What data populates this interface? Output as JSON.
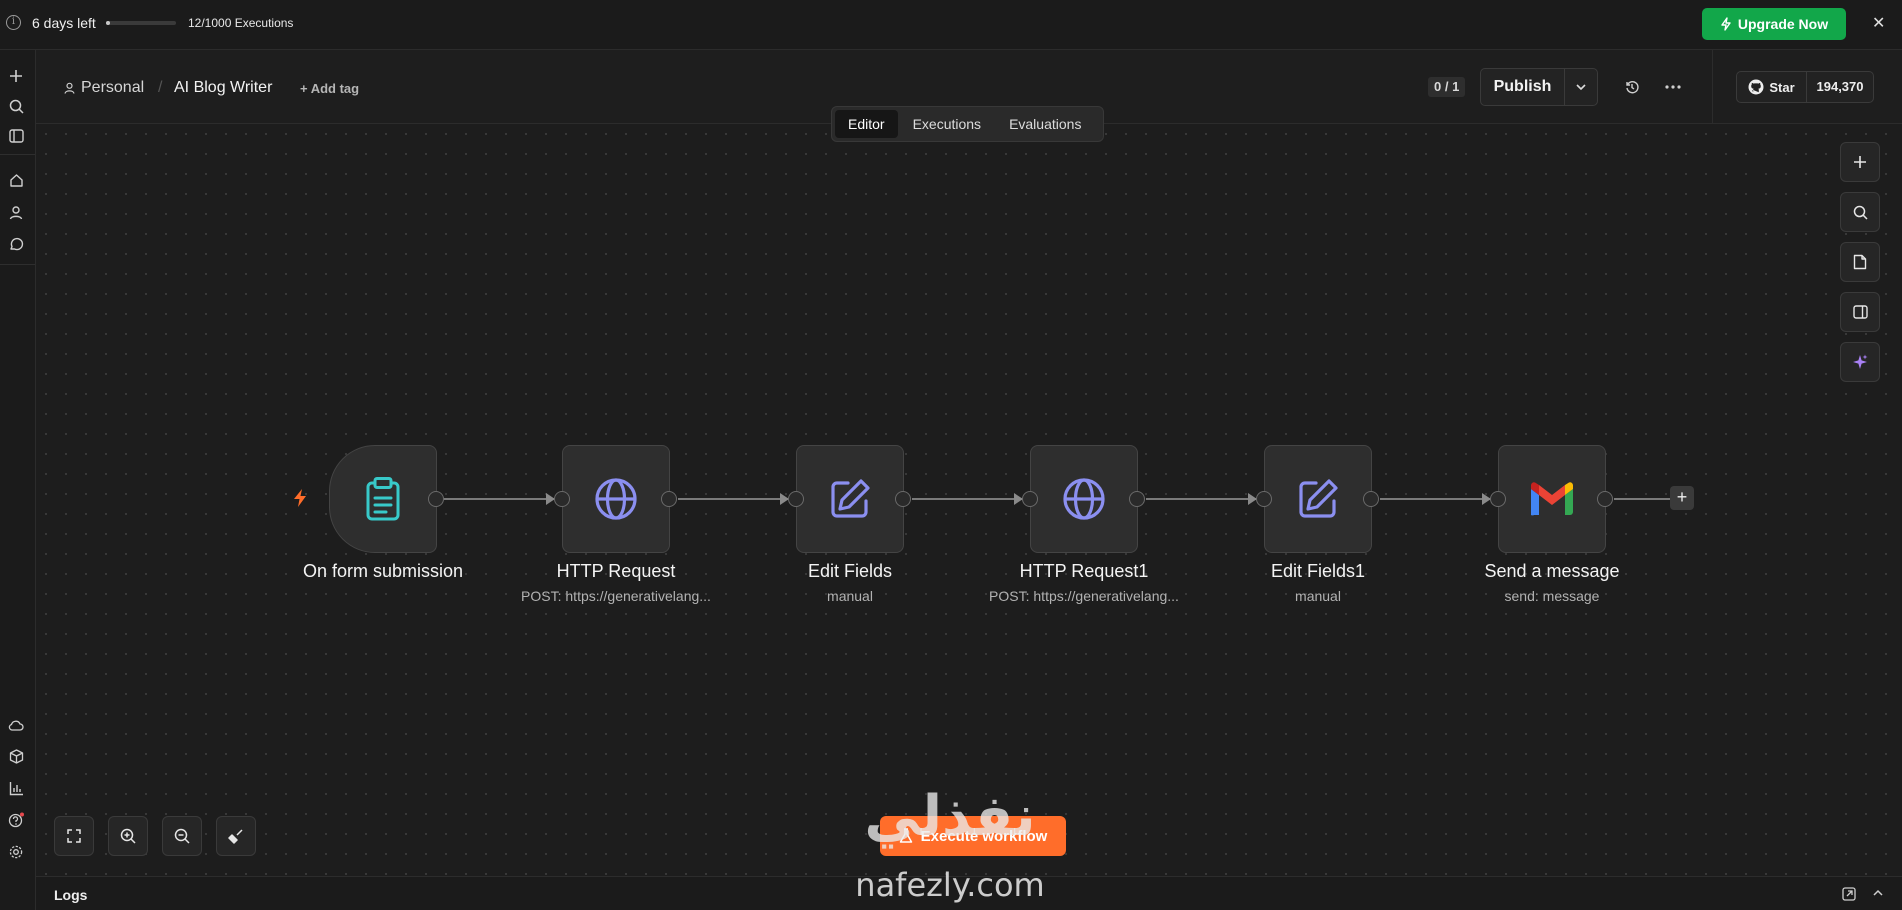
{
  "banner": {
    "trial_text": "6 days left",
    "executions_progress": 0.012,
    "executions_text": "12/1000 Executions",
    "upgrade_label": "Upgrade Now"
  },
  "header": {
    "project": "Personal",
    "workflow_title": "AI Blog Writer",
    "add_tag": "+ Add tag",
    "version_counter": "0 / 1",
    "publish_label": "Publish"
  },
  "github": {
    "star_label": "Star",
    "star_count": "194,370"
  },
  "tabs": [
    {
      "label": "Editor",
      "active": true
    },
    {
      "label": "Executions",
      "active": false
    },
    {
      "label": "Evaluations",
      "active": false
    }
  ],
  "nodes": [
    {
      "label": "On form submission",
      "subtitle": "",
      "icon": "clipboard-icon",
      "color": "#38c9c9"
    },
    {
      "label": "HTTP Request",
      "subtitle": "POST: https://generativelang...",
      "icon": "globe-icon",
      "color": "#8b8ff0"
    },
    {
      "label": "Edit Fields",
      "subtitle": "manual",
      "icon": "edit-icon",
      "color": "#8b8ff0"
    },
    {
      "label": "HTTP Request1",
      "subtitle": "POST: https://generativelang...",
      "icon": "globe-icon",
      "color": "#8b8ff0"
    },
    {
      "label": "Edit Fields1",
      "subtitle": "manual",
      "icon": "edit-icon",
      "color": "#8b8ff0"
    },
    {
      "label": "Send a message",
      "subtitle": "send: message",
      "icon": "gmail-icon",
      "color": "#ea4335"
    }
  ],
  "execute_label": "Execute workflow",
  "logs_label": "Logs",
  "watermark": {
    "arabic": "نفذلي",
    "domain": "nafezly.com"
  },
  "colors": {
    "accent_green": "#12a74a",
    "execute_orange": "#ff6d2a"
  }
}
